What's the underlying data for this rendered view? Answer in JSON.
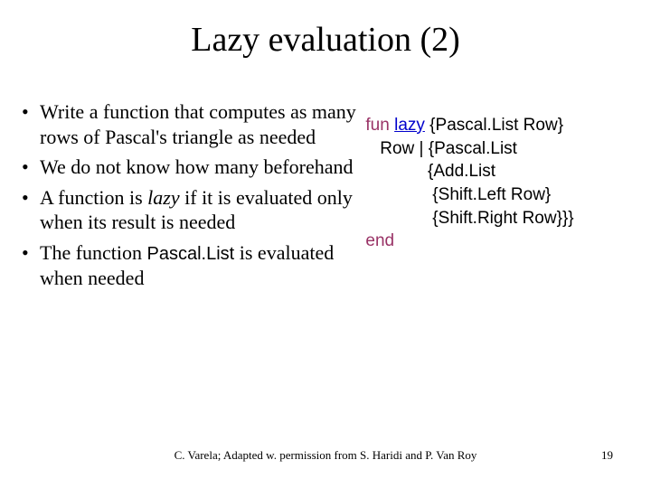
{
  "title": "Lazy evaluation (2)",
  "bullets": {
    "b1a": "Write a function that computes as many rows of Pascal's triangle as needed",
    "b2": "We do not know how many beforehand",
    "b3a": "A function is ",
    "b3_lazy": "lazy",
    "b3b": " if it is evaluated only when its result is needed",
    "b4a": "The function ",
    "b4_mono": "Pascal.List",
    "b4b": " is evaluated when needed"
  },
  "code": {
    "fun": "fun",
    "lazy": "lazy",
    "l1b": " {Pascal.List Row}",
    "l2": "   Row | {Pascal.List",
    "l3": "             {Add.List",
    "l4": "              {Shift.Left Row}",
    "l5": "              {Shift.Right Row}}}",
    "end": "end"
  },
  "footer": "C. Varela;  Adapted w. permission from S. Haridi and P. Van Roy",
  "page": "19"
}
